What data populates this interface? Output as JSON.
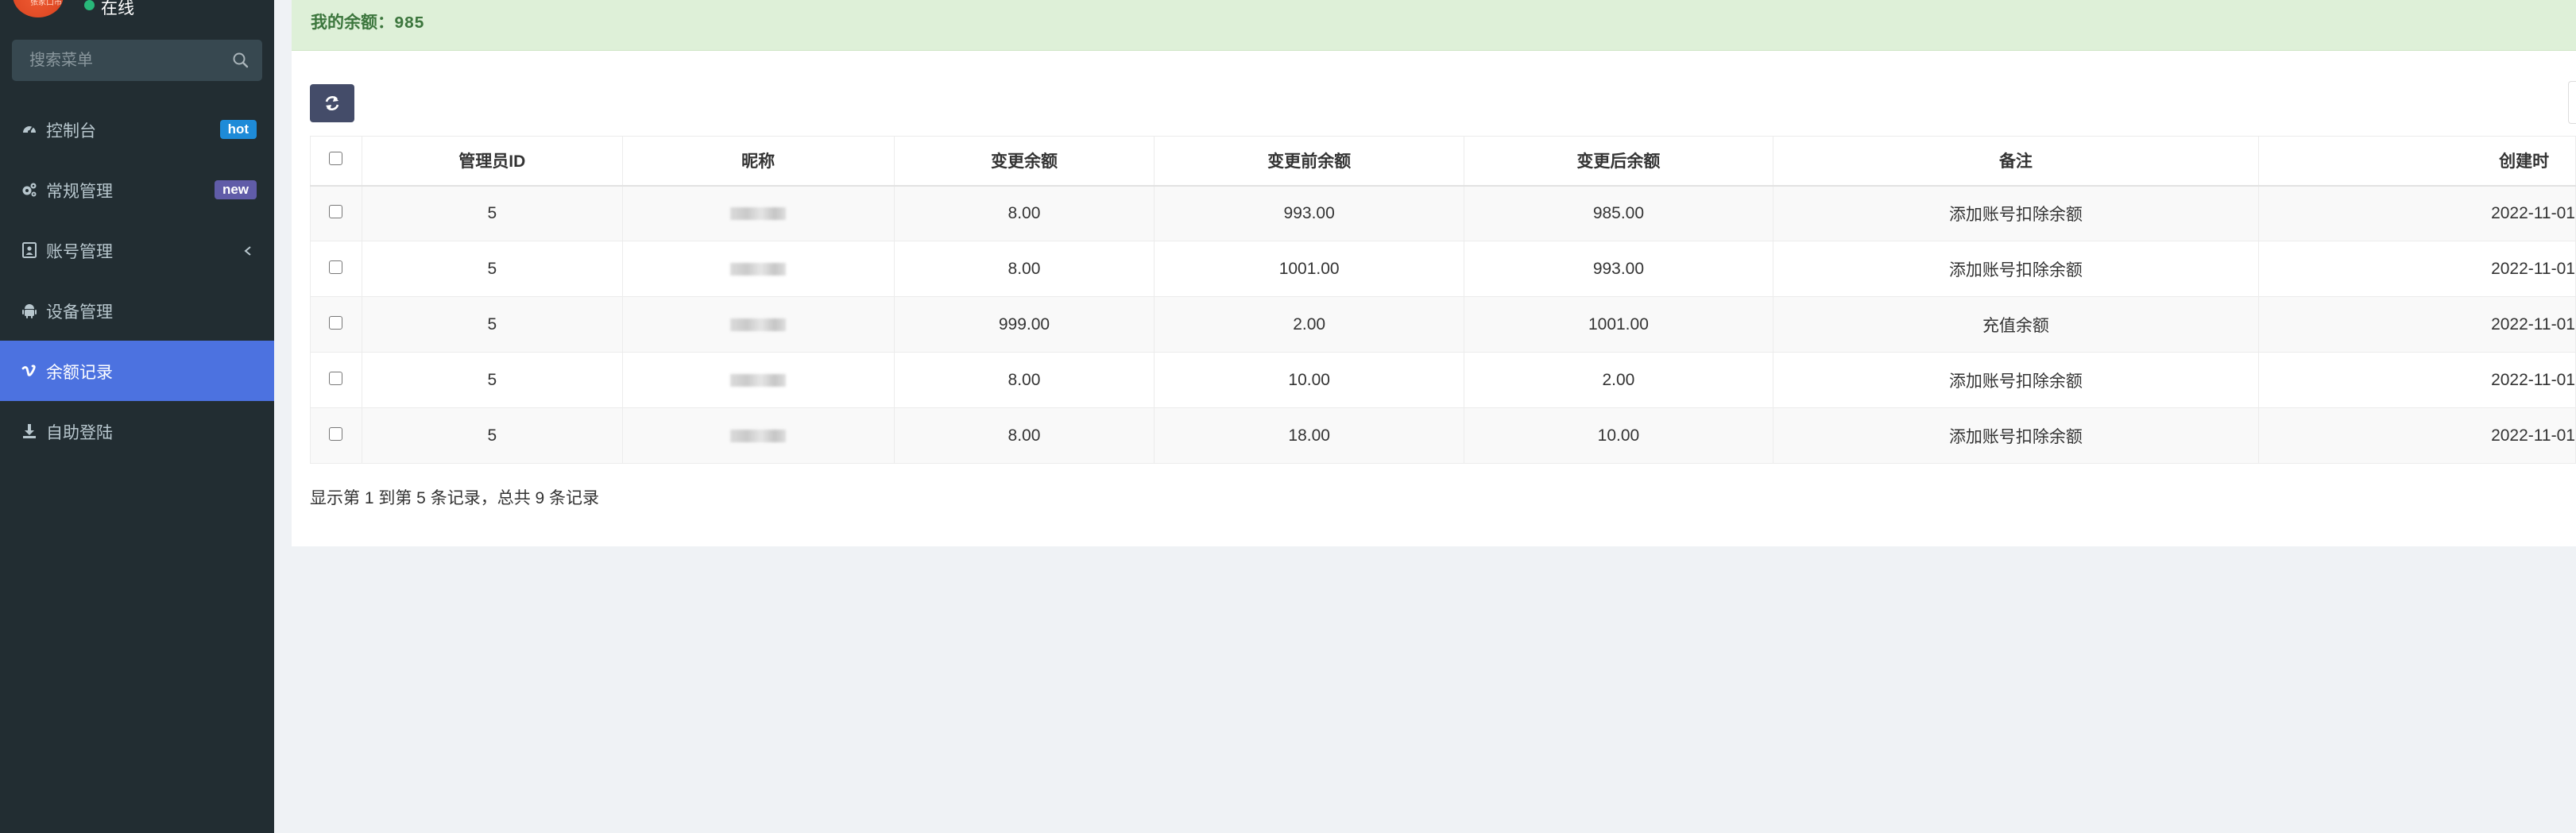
{
  "sidebar": {
    "avatar_text": "张家口市",
    "status": "在线",
    "search": {
      "placeholder": "搜索菜单"
    },
    "items": [
      {
        "label": "控制台",
        "icon": "dashboard-icon",
        "badge": "hot"
      },
      {
        "label": "常规管理",
        "icon": "cogs-icon",
        "badge": "new"
      },
      {
        "label": "账号管理",
        "icon": "id-card-icon",
        "chevron": true
      },
      {
        "label": "设备管理",
        "icon": "android-icon"
      },
      {
        "label": "余额记录",
        "icon": "vimeo-icon",
        "active": true
      },
      {
        "label": "自助登陆",
        "icon": "download-icon"
      }
    ]
  },
  "alert": {
    "text": "我的余额：985"
  },
  "colors": {
    "sidebar_bg": "#222d32",
    "active_item": "#4c72e0",
    "badge_hot": "#1e8bd8",
    "badge_new": "#605ca8",
    "alert_bg": "#def0d8",
    "alert_text": "#3c763d",
    "refresh_btn": "#444c69"
  },
  "table": {
    "columns": [
      "管理员ID",
      "昵称",
      "变更余额",
      "变更前余额",
      "变更后余额",
      "备注",
      "创建时"
    ],
    "rows": [
      {
        "admin_id": "5",
        "change": "8.00",
        "before": "993.00",
        "after": "985.00",
        "note": "添加账号扣除余额",
        "created": "2022-11-01"
      },
      {
        "admin_id": "5",
        "change": "8.00",
        "before": "1001.00",
        "after": "993.00",
        "note": "添加账号扣除余额",
        "created": "2022-11-01"
      },
      {
        "admin_id": "5",
        "change": "999.00",
        "before": "2.00",
        "after": "1001.00",
        "note": "充值余额",
        "created": "2022-11-01"
      },
      {
        "admin_id": "5",
        "change": "8.00",
        "before": "10.00",
        "after": "2.00",
        "note": "添加账号扣除余额",
        "created": "2022-11-01"
      },
      {
        "admin_id": "5",
        "change": "8.00",
        "before": "18.00",
        "after": "10.00",
        "note": "添加账号扣除余额",
        "created": "2022-11-01"
      }
    ]
  },
  "pagination": {
    "info": "显示第 1 到第 5 条记录，总共 9 条记录"
  }
}
